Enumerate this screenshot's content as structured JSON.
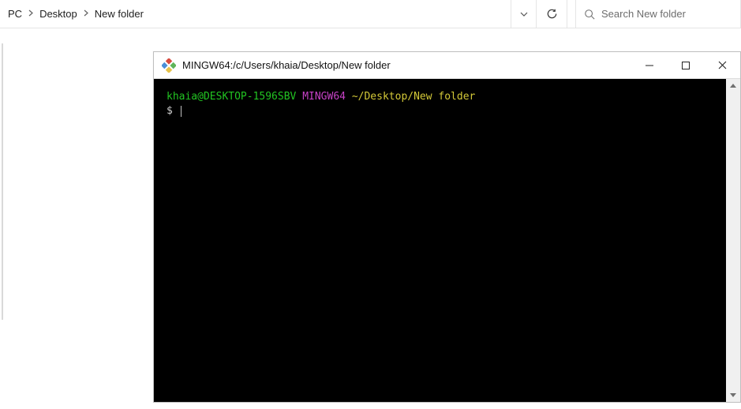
{
  "explorer": {
    "breadcrumb": [
      "PC",
      "Desktop",
      "New folder"
    ],
    "search_placeholder": "Search New folder"
  },
  "terminal": {
    "title": "MINGW64:/c/Users/khaia/Desktop/New folder",
    "prompt": {
      "user_host": "khaia@DESKTOP-1596SBV",
      "env": "MINGW64",
      "path": "~/Desktop/New folder"
    },
    "prompt_symbol": "$"
  }
}
